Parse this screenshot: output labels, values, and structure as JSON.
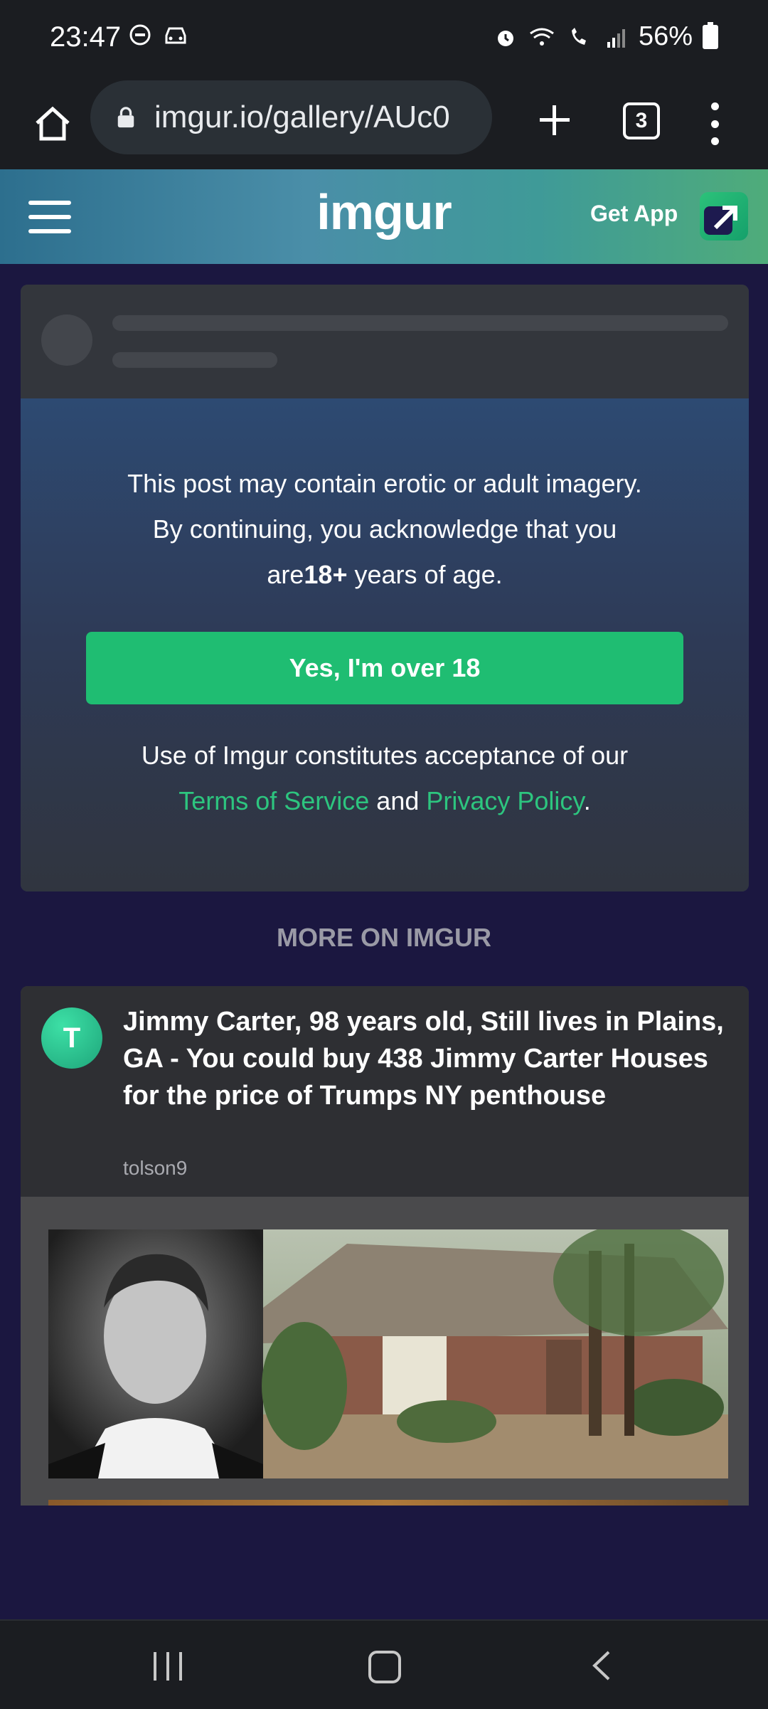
{
  "status_bar": {
    "time": "23:47",
    "battery": "56%",
    "icons": [
      "do-not-disturb-icon",
      "car-icon",
      "alarm-icon",
      "wifi-icon",
      "wifi-calling-icon",
      "signal-icon",
      "battery-icon"
    ]
  },
  "browser": {
    "url": "imgur.io/gallery/AUc0",
    "tab_count": "3"
  },
  "header": {
    "logo": "imgur",
    "get_app": "Get App"
  },
  "warning": {
    "line1": "This post may contain erotic or adult imagery.",
    "line2": "By continuing, you acknowledge that you",
    "line3_prefix": "are",
    "line3_bold": "18+",
    "line3_suffix": " years of age.",
    "confirm_button": "Yes, I'm over 18",
    "terms_prefix": "Use of Imgur constitutes acceptance of our",
    "terms_link": "Terms of Service",
    "terms_and": " and ",
    "privacy_link": "Privacy Policy",
    "terms_period": "."
  },
  "more_heading": "MORE ON IMGUR",
  "gallery": {
    "avatar_letter": "T",
    "title": "Jimmy Carter, 98 years old, Still lives in Plains, GA -  You could buy 438 Jimmy Carter Houses for the price of Trumps NY penthouse",
    "author": "tolson9"
  },
  "colors": {
    "accent_green": "#1fbd72",
    "link_green": "#2dc57f",
    "page_bg": "#1b1740"
  }
}
